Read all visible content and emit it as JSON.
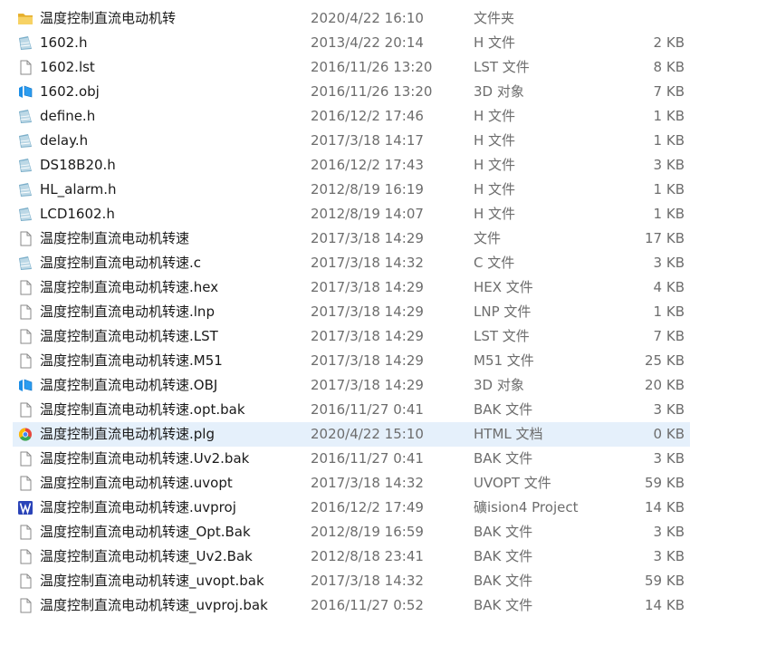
{
  "files": [
    {
      "name": "温度控制直流电动机转",
      "date": "2020/4/22 16:10",
      "type": "文件夹",
      "size": "",
      "icon": "folder-icon"
    },
    {
      "name": "1602.h",
      "date": "2013/4/22 20:14",
      "type": "H 文件",
      "size": "2 KB",
      "icon": "source-file-icon"
    },
    {
      "name": "1602.lst",
      "date": "2016/11/26 13:20",
      "type": "LST 文件",
      "size": "8 KB",
      "icon": "blank-file-icon"
    },
    {
      "name": "1602.obj",
      "date": "2016/11/26 13:20",
      "type": "3D 对象",
      "size": "7 KB",
      "icon": "3d-object-icon"
    },
    {
      "name": "define.h",
      "date": "2016/12/2 17:46",
      "type": "H 文件",
      "size": "1 KB",
      "icon": "source-file-icon"
    },
    {
      "name": "delay.h",
      "date": "2017/3/18 14:17",
      "type": "H 文件",
      "size": "1 KB",
      "icon": "source-file-icon"
    },
    {
      "name": "DS18B20.h",
      "date": "2016/12/2 17:43",
      "type": "H 文件",
      "size": "3 KB",
      "icon": "source-file-icon"
    },
    {
      "name": "HL_alarm.h",
      "date": "2012/8/19 16:19",
      "type": "H 文件",
      "size": "1 KB",
      "icon": "source-file-icon"
    },
    {
      "name": "LCD1602.h",
      "date": "2012/8/19 14:07",
      "type": "H 文件",
      "size": "1 KB",
      "icon": "source-file-icon"
    },
    {
      "name": "温度控制直流电动机转速",
      "date": "2017/3/18 14:29",
      "type": "文件",
      "size": "17 KB",
      "icon": "blank-file-icon"
    },
    {
      "name": "温度控制直流电动机转速.c",
      "date": "2017/3/18 14:32",
      "type": "C 文件",
      "size": "3 KB",
      "icon": "source-file-icon"
    },
    {
      "name": "温度控制直流电动机转速.hex",
      "date": "2017/3/18 14:29",
      "type": "HEX 文件",
      "size": "4 KB",
      "icon": "blank-file-icon"
    },
    {
      "name": "温度控制直流电动机转速.lnp",
      "date": "2017/3/18 14:29",
      "type": "LNP 文件",
      "size": "1 KB",
      "icon": "blank-file-icon"
    },
    {
      "name": "温度控制直流电动机转速.LST",
      "date": "2017/3/18 14:29",
      "type": "LST 文件",
      "size": "7 KB",
      "icon": "blank-file-icon"
    },
    {
      "name": "温度控制直流电动机转速.M51",
      "date": "2017/3/18 14:29",
      "type": "M51 文件",
      "size": "25 KB",
      "icon": "blank-file-icon"
    },
    {
      "name": "温度控制直流电动机转速.OBJ",
      "date": "2017/3/18 14:29",
      "type": "3D 对象",
      "size": "20 KB",
      "icon": "3d-object-icon"
    },
    {
      "name": "温度控制直流电动机转速.opt.bak",
      "date": "2016/11/27 0:41",
      "type": "BAK 文件",
      "size": "3 KB",
      "icon": "blank-file-icon"
    },
    {
      "name": "温度控制直流电动机转速.plg",
      "date": "2020/4/22 15:10",
      "type": "HTML 文档",
      "size": "0 KB",
      "icon": "chrome-html-icon",
      "selected": true
    },
    {
      "name": "温度控制直流电动机转速.Uv2.bak",
      "date": "2016/11/27 0:41",
      "type": "BAK 文件",
      "size": "3 KB",
      "icon": "blank-file-icon"
    },
    {
      "name": "温度控制直流电动机转速.uvopt",
      "date": "2017/3/18 14:32",
      "type": "UVOPT 文件",
      "size": "59 KB",
      "icon": "blank-file-icon"
    },
    {
      "name": "温度控制直流电动机转速.uvproj",
      "date": "2016/12/2 17:49",
      "type": "礦ision4 Project",
      "size": "14 KB",
      "icon": "keil-uvision-icon"
    },
    {
      "name": "温度控制直流电动机转速_Opt.Bak",
      "date": "2012/8/19 16:59",
      "type": "BAK 文件",
      "size": "3 KB",
      "icon": "blank-file-icon"
    },
    {
      "name": "温度控制直流电动机转速_Uv2.Bak",
      "date": "2012/8/18 23:41",
      "type": "BAK 文件",
      "size": "3 KB",
      "icon": "blank-file-icon"
    },
    {
      "name": "温度控制直流电动机转速_uvopt.bak",
      "date": "2017/3/18 14:32",
      "type": "BAK 文件",
      "size": "59 KB",
      "icon": "blank-file-icon"
    },
    {
      "name": "温度控制直流电动机转速_uvproj.bak",
      "date": "2016/11/27 0:52",
      "type": "BAK 文件",
      "size": "14 KB",
      "icon": "blank-file-icon"
    }
  ],
  "colors": {
    "selected_row": "#e5f0fb",
    "folder": "#f4c64a",
    "obj_blue": "#1c8ee6"
  }
}
